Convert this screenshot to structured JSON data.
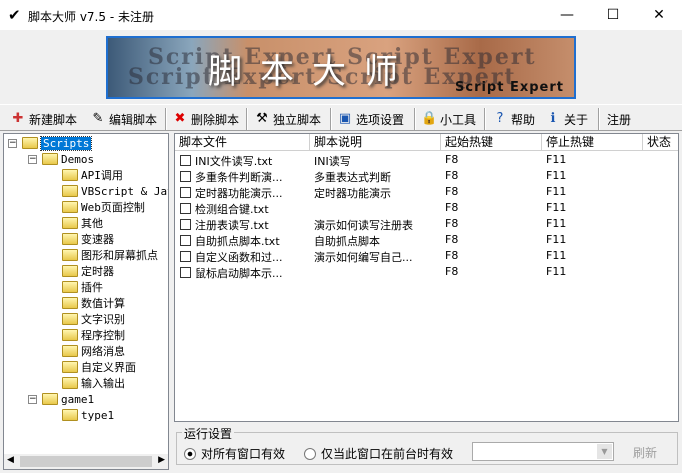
{
  "window": {
    "title": "脚本大师 v7.5 - 未注册",
    "minimize": "—",
    "maximize": "☐",
    "close": "✕"
  },
  "banner": {
    "main": "脚本大师",
    "sub": "Script Expert",
    "bg1": "Script Expert Script Expert",
    "bg2": "Script Expert Script Expert"
  },
  "toolbar": [
    {
      "label": "新建脚本",
      "icon": "new-script-icon"
    },
    {
      "label": "编辑脚本",
      "icon": "edit-script-icon"
    },
    {
      "label": "删除脚本",
      "icon": "delete-script-icon"
    },
    {
      "label": "独立脚本",
      "icon": "standalone-script-icon"
    },
    {
      "label": "选项设置",
      "icon": "options-icon"
    },
    {
      "label": "小工具",
      "icon": "tools-icon"
    },
    {
      "label": "帮助",
      "icon": "help-icon"
    },
    {
      "label": "关于",
      "icon": "about-icon"
    },
    {
      "label": "注册"
    }
  ],
  "tree": {
    "root": "Scripts",
    "demos": "Demos",
    "demo_items": [
      "API调用",
      "VBScript & JavaScript",
      "Web页面控制",
      "其他",
      "变速器",
      "图形和屏幕抓点",
      "定时器",
      "插件",
      "数值计算",
      "文字识别",
      "程序控制",
      "网络消息",
      "自定义界面",
      "输入输出"
    ],
    "game": "game1",
    "game_items": [
      "type1"
    ]
  },
  "list": {
    "columns": [
      "脚本文件",
      "脚本说明",
      "起始热键",
      "停止热键",
      "状态"
    ],
    "rows": [
      [
        "INI文件读写.txt",
        "INI读写",
        "F8",
        "F11"
      ],
      [
        "多重条件判断演...",
        "多重表达式判断",
        "F8",
        "F11"
      ],
      [
        "定时器功能演示...",
        "定时器功能演示",
        "F8",
        "F11"
      ],
      [
        "检测组合键.txt",
        "",
        "F8",
        "F11"
      ],
      [
        "注册表读写.txt",
        "演示如何读写注册表",
        "F8",
        "F11"
      ],
      [
        "自助抓点脚本.txt",
        "自助抓点脚本",
        "F8",
        "F11"
      ],
      [
        "自定义函数和过...",
        "演示如何编写自己...",
        "F8",
        "F11"
      ],
      [
        "鼠标启动脚本示...",
        "",
        "F8",
        "F11"
      ]
    ]
  },
  "run_settings": {
    "title": "运行设置",
    "option_all": "对所有窗口有效",
    "option_fg": "仅当此窗口在前台时有效",
    "selected": "all",
    "refresh": "刷新",
    "combo_value": ""
  }
}
